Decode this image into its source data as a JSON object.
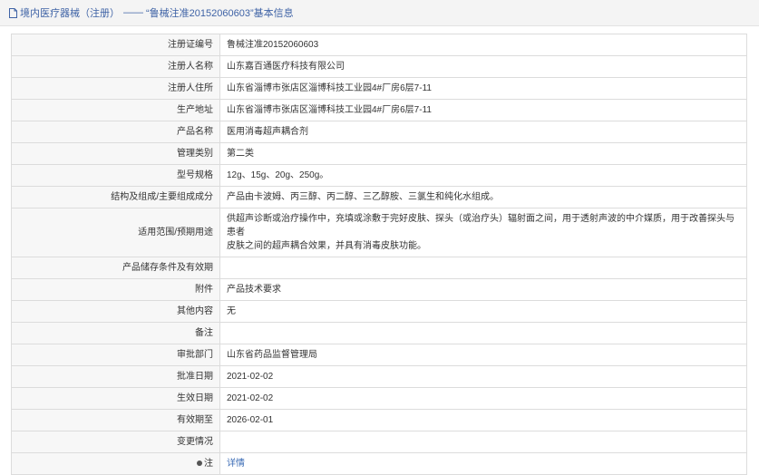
{
  "header": {
    "category": "境内医疗器械（注册）",
    "separator": "——",
    "title": "“鲁械注准20152060603”基本信息"
  },
  "rows": [
    {
      "label": "注册证编号",
      "value": "鲁械注准20152060603"
    },
    {
      "label": "注册人名称",
      "value": "山东嘉百通医疗科技有限公司"
    },
    {
      "label": "注册人住所",
      "value": "山东省淄博市张店区淄博科技工业园4#厂房6层7-11"
    },
    {
      "label": "生产地址",
      "value": "山东省淄博市张店区淄博科技工业园4#厂房6层7-11"
    },
    {
      "label": "产品名称",
      "value": "医用消毒超声耦合剂"
    },
    {
      "label": "管理类别",
      "value": "第二类"
    },
    {
      "label": "型号规格",
      "value": "12g、15g、20g、250g。"
    },
    {
      "label": "结构及组成/主要组成成分",
      "value": "产品由卡波姆、丙三醇、丙二醇、三乙醇胺、三氯生和纯化水组成。"
    },
    {
      "label": "适用范围/预期用途",
      "value_line1": "供超声诊断或治疗操作中，充填或涂敷于完好皮肤、探头（或治疗头）辐射面之间，用于透射声波的中介媒质，用于改善探头与患者",
      "value_line2": "皮肤之间的超声耦合效果，并具有消毒皮肤功能。"
    },
    {
      "label": "产品储存条件及有效期",
      "value": ""
    },
    {
      "label": "附件",
      "value": "产品技术要求"
    },
    {
      "label": "其他内容",
      "value": "无"
    },
    {
      "label": "备注",
      "value": ""
    },
    {
      "label": "审批部门",
      "value": "山东省药品监督管理局"
    },
    {
      "label": "批准日期",
      "value": "2021-02-02"
    },
    {
      "label": "生效日期",
      "value": "2021-02-02"
    },
    {
      "label": "有效期至",
      "value": "2026-02-01"
    },
    {
      "label": "变更情况",
      "value": ""
    },
    {
      "label": "注",
      "value": "详情"
    }
  ],
  "colors": {
    "header_text": "#3f63a6",
    "link": "#3a6bb5",
    "label_bg": "#f7f7f7"
  },
  "icons": [
    "document-icon",
    "pin-icon"
  ]
}
